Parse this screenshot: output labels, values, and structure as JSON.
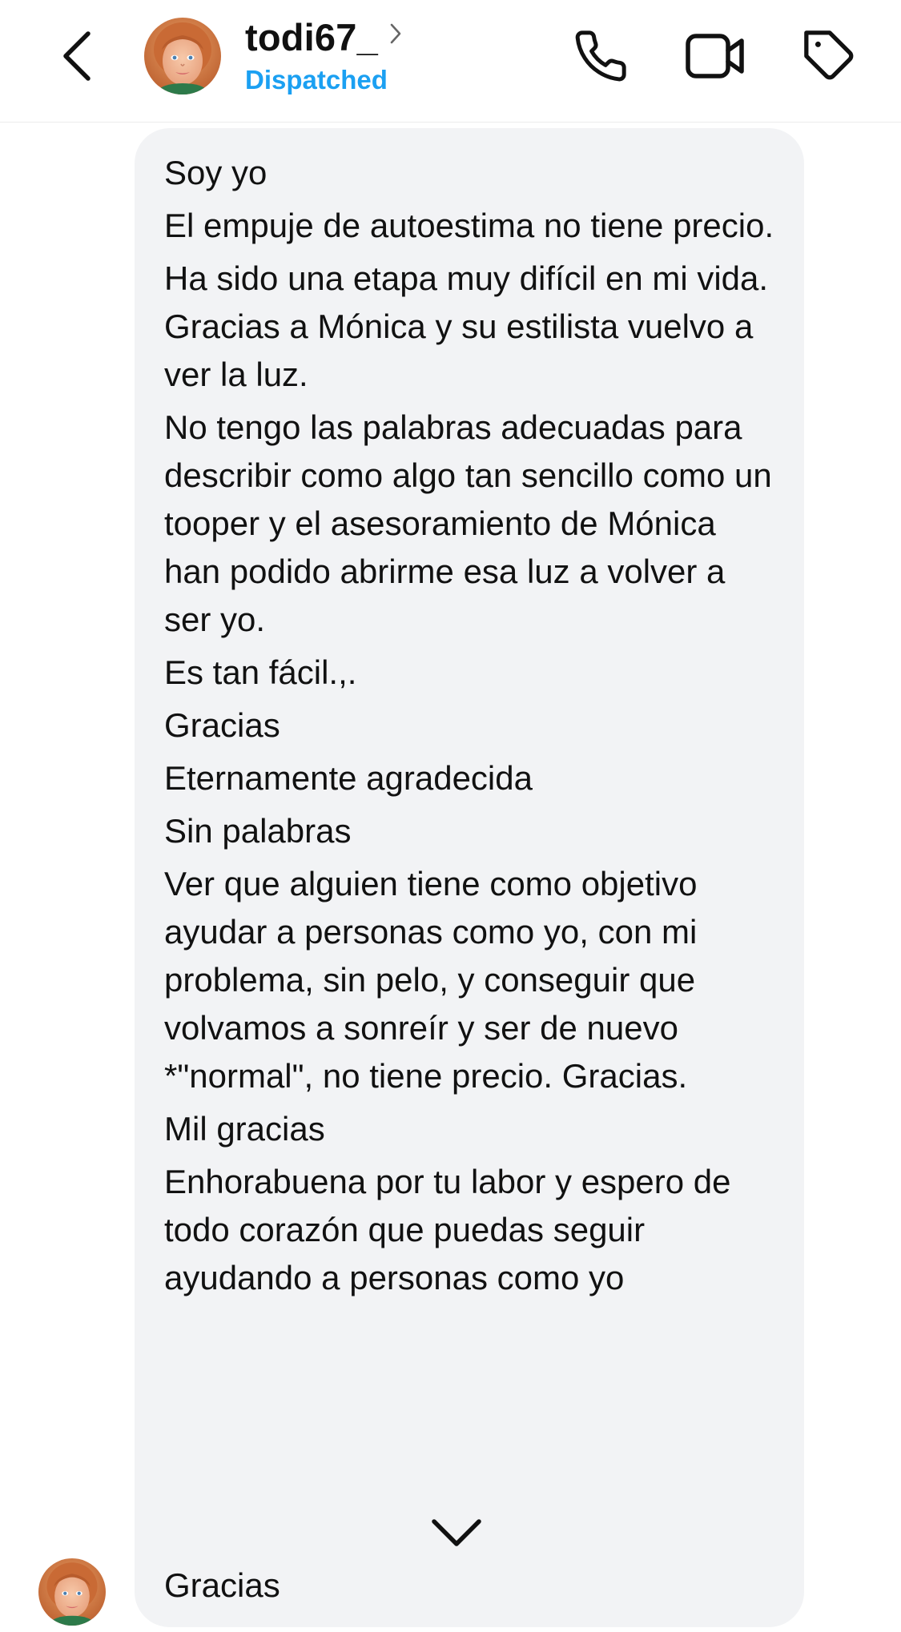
{
  "header": {
    "username": "todi67_",
    "status": "Dispatched",
    "icons": {
      "back": "back-chevron-icon",
      "profile_chevron": "chevron-right-icon",
      "phone": "phone-icon",
      "video": "video-camera-icon",
      "tag": "tag-icon"
    },
    "status_color": "#1ba0f2"
  },
  "message": {
    "lines": [
      "Soy yo",
      "El empuje de autoestima no tiene precio.",
      "Ha sido una etapa muy difícil en mi vida. Gracias a Mónica y su estilista vuelvo a ver la luz.",
      "No tengo las palabras adecuadas para describir como algo tan sencillo como un tooper y el asesoramiento de Mónica han podido abrirme esa luz a volver a ser yo.",
      "Es tan fácil.,.",
      "Gracias",
      "Eternamente agradecida",
      "Sin palabras",
      "Ver que alguien tiene como objetivo ayudar a personas como yo, con mi problema, sin pelo, y conseguir que volvamos a sonreír y ser de nuevo *\"normal\", no tiene precio. Gracias.",
      "Mil gracias",
      "Enhorabuena por tu labor y espero de todo corazón que puedas seguir ayudando a personas como yo"
    ],
    "last_line": "Gracias",
    "expand_icon": "chevron-down-icon",
    "bubble_color": "#f2f3f5"
  }
}
